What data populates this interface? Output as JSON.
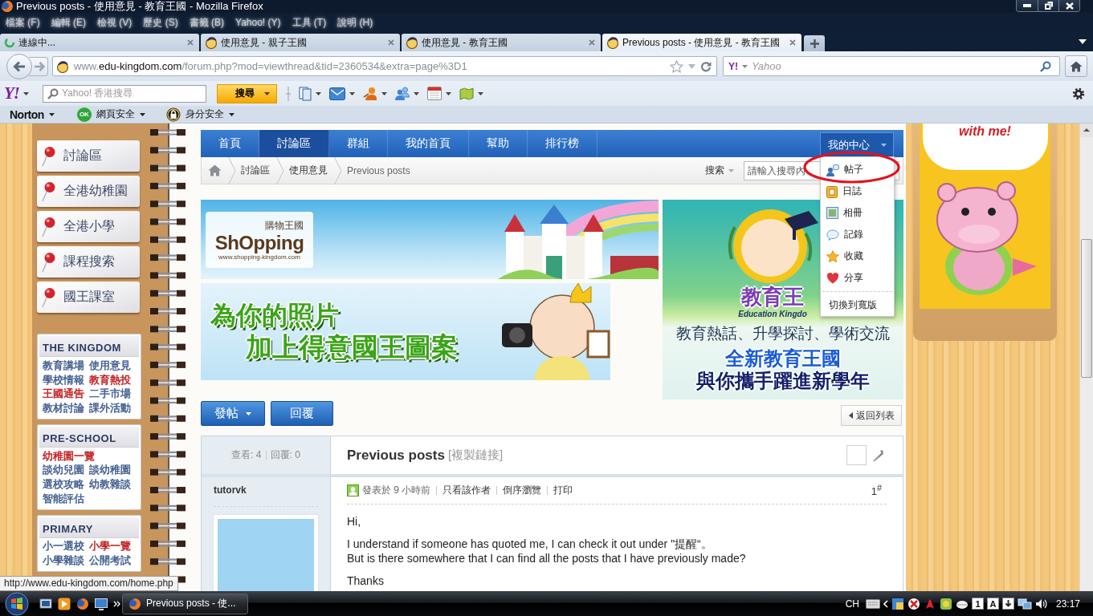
{
  "window": {
    "title": "Previous posts - 使用意見 - 教育王國 - Mozilla Firefox"
  },
  "menu_bar": [
    "檔案 (F)",
    "編輯 (E)",
    "檢視 (V)",
    "歷史 (S)",
    "書籤 (B)",
    "Yahoo! (Y)",
    "工具 (T)",
    "說明 (H)"
  ],
  "tabs": [
    {
      "label": "連線中...",
      "selected": false,
      "loading": true
    },
    {
      "label": "使用意見 - 親子王國",
      "selected": false,
      "loading": false
    },
    {
      "label": "使用意見 - 教育王國",
      "selected": false,
      "loading": false
    },
    {
      "label": "Previous posts - 使用意見 - 教育王國",
      "selected": true,
      "loading": false
    }
  ],
  "address_bar": {
    "prefix": "www.",
    "domain": "edu-kingdom.com",
    "path": "/forum.php?mod=viewthread&tid=2360534&extra=page%3D1"
  },
  "search_bar": {
    "engine_logo": "Y!",
    "placeholder": "Yahoo"
  },
  "yahoo_toolbar": {
    "logo": "Y!",
    "placeholder": "Yahoo! 香港搜尋",
    "button": "搜尋"
  },
  "norton_toolbar": {
    "brand": "Norton",
    "items": [
      {
        "kind": "ok",
        "badge": "OK",
        "label": "網頁安全"
      },
      {
        "kind": "lock",
        "label": "身分安全"
      }
    ]
  },
  "sidebar": {
    "buttons": [
      "討論區",
      "全港幼稚園",
      "全港小學",
      "課程搜索",
      "國王課室"
    ],
    "sections": [
      {
        "title": "THE KINGDOM",
        "rows": [
          [
            {
              "label": "教育講場",
              "color": "#3d5a8c"
            },
            {
              "label": "使用意見",
              "color": "#3d5a8c"
            }
          ],
          [
            {
              "label": "學校情報",
              "color": "#3d5a8c"
            },
            {
              "label": "教育熱投",
              "color": "#c0191b"
            }
          ],
          [
            {
              "label": "王國通告",
              "color": "#c0191b"
            },
            {
              "label": "二手市場",
              "color": "#3d5a8c"
            }
          ],
          [
            {
              "label": "教材討論",
              "color": "#3d5a8c"
            },
            {
              "label": "課外活動",
              "color": "#3d5a8c"
            }
          ]
        ]
      },
      {
        "title": "PRE-SCHOOL",
        "rows": [
          [
            {
              "label": "幼稚園一覽",
              "color": "#c0191b"
            }
          ],
          [
            {
              "label": "談幼兒園",
              "color": "#3d5a8c"
            },
            {
              "label": "談幼稚園",
              "color": "#3d5a8c"
            }
          ],
          [
            {
              "label": "選校攻略",
              "color": "#3d5a8c"
            },
            {
              "label": "幼教雜談",
              "color": "#3d5a8c"
            }
          ],
          [
            {
              "label": "智能評估",
              "color": "#3d5a8c"
            }
          ]
        ]
      },
      {
        "title": "PRIMARY",
        "rows": [
          [
            {
              "label": "小一選校",
              "color": "#3d5a8c"
            },
            {
              "label": "小學一覽",
              "color": "#c0191b"
            }
          ],
          [
            {
              "label": "小學雜談",
              "color": "#3d5a8c"
            },
            {
              "label": "公開考試",
              "color": "#3d5a8c"
            }
          ]
        ]
      }
    ]
  },
  "forum_nav": {
    "items": [
      {
        "label": "首頁",
        "selected": false
      },
      {
        "label": "討論區",
        "selected": true
      },
      {
        "label": "群組",
        "selected": false
      },
      {
        "label": "我的首頁",
        "selected": false
      },
      {
        "label": "幫助",
        "selected": false
      },
      {
        "label": "排行榜",
        "selected": false
      }
    ],
    "user_menu": {
      "label": "我的中心",
      "expanded": true,
      "items": [
        {
          "kind": "posts",
          "label": "帖子"
        },
        {
          "kind": "blog",
          "label": "日誌"
        },
        {
          "kind": "album",
          "label": "相冊"
        },
        {
          "kind": "doing",
          "label": "記錄"
        },
        {
          "kind": "favorite",
          "label": "收藏"
        },
        {
          "kind": "share",
          "label": "分享"
        }
      ],
      "footer": "切換到寬版"
    }
  },
  "breadcrumb": [
    "討論區",
    "使用意見",
    "Previous posts"
  ],
  "search": {
    "scope": "搜索",
    "placeholder": "請輸入搜尋內"
  },
  "banners": {
    "shopping": {
      "title": "購物王國",
      "logo": "ShOpping",
      "site": "www.shopping-kingdom.com"
    },
    "photo": {
      "lines": [
        "為你的照片",
        "加上得意國王圖案"
      ]
    },
    "education": {
      "logo_title": "教育王",
      "logo_subtitle": "Education Kingdo",
      "tagline": "教育熱話、升學探討、學術交流",
      "headline": [
        "全新教育王國",
        "與你攜手躍進新學年"
      ]
    }
  },
  "actions": {
    "new_post": "發帖",
    "reply": "回覆",
    "back": "返回列表"
  },
  "thread": {
    "stats": [
      "查看: 4",
      "回覆: 0"
    ],
    "title": "Previous posts",
    "copy_link": "[複製鏈接]"
  },
  "post": {
    "author": "tutorvk",
    "posted": "發表於 9 小時前",
    "links": [
      "只看該作者",
      "倒序瀏覽",
      "打印"
    ],
    "floor": "1$^{#}$",
    "paragraphs": [
      [
        "Hi,"
      ],
      [
        "I understand if someone has quoted me, I can check it out under \"提醒“。",
        "But is there somewhere that I can find all the posts that I have previously made?"
      ],
      [
        "Thanks"
      ]
    ]
  },
  "promo_card": {
    "caption": "with me!"
  },
  "status_tooltip": "http://www.edu-kingdom.com/home.php",
  "taskbar": {
    "window_button": "Previous posts - 使...",
    "language": "CH",
    "ime_tiles": [
      "1",
      "A"
    ],
    "clock": "23:17"
  }
}
